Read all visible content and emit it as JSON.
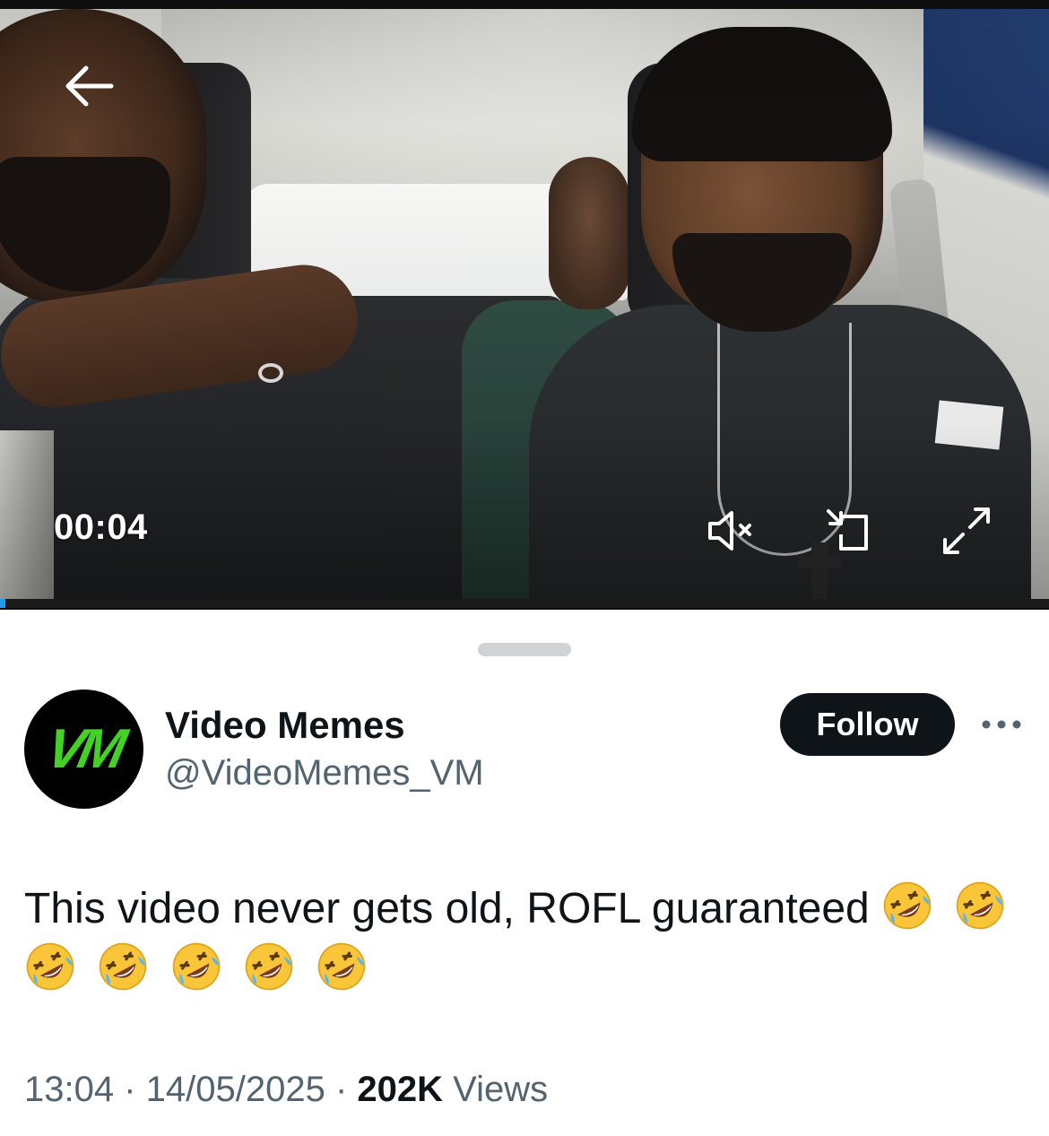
{
  "video": {
    "timestamp": "00:04",
    "progress": 0.005,
    "icons": {
      "back": "arrow-left-icon",
      "mute": "speaker-muted-icon",
      "pip": "picture-in-picture-icon",
      "fullscreen": "expand-icon"
    }
  },
  "author": {
    "avatar_text": "VM",
    "name": "Video Memes",
    "handle": "@VideoMemes_VM"
  },
  "actions": {
    "follow_label": "Follow",
    "more_icon": "more-horizontal-icon"
  },
  "tweet": {
    "text": "This video never gets old, ROFL guaranteed",
    "emoji": "rolling-on-the-floor-laughing",
    "emoji_count": 7
  },
  "meta": {
    "time": "13:04",
    "separator": " · ",
    "date": "14/05/2025",
    "views_count": "202K",
    "views_label": "Views"
  },
  "colors": {
    "accent": "#1d9bf0",
    "text_primary": "#0f1419",
    "text_secondary": "#536471",
    "avatar_bg": "#000000",
    "avatar_fg": "#43d126"
  }
}
